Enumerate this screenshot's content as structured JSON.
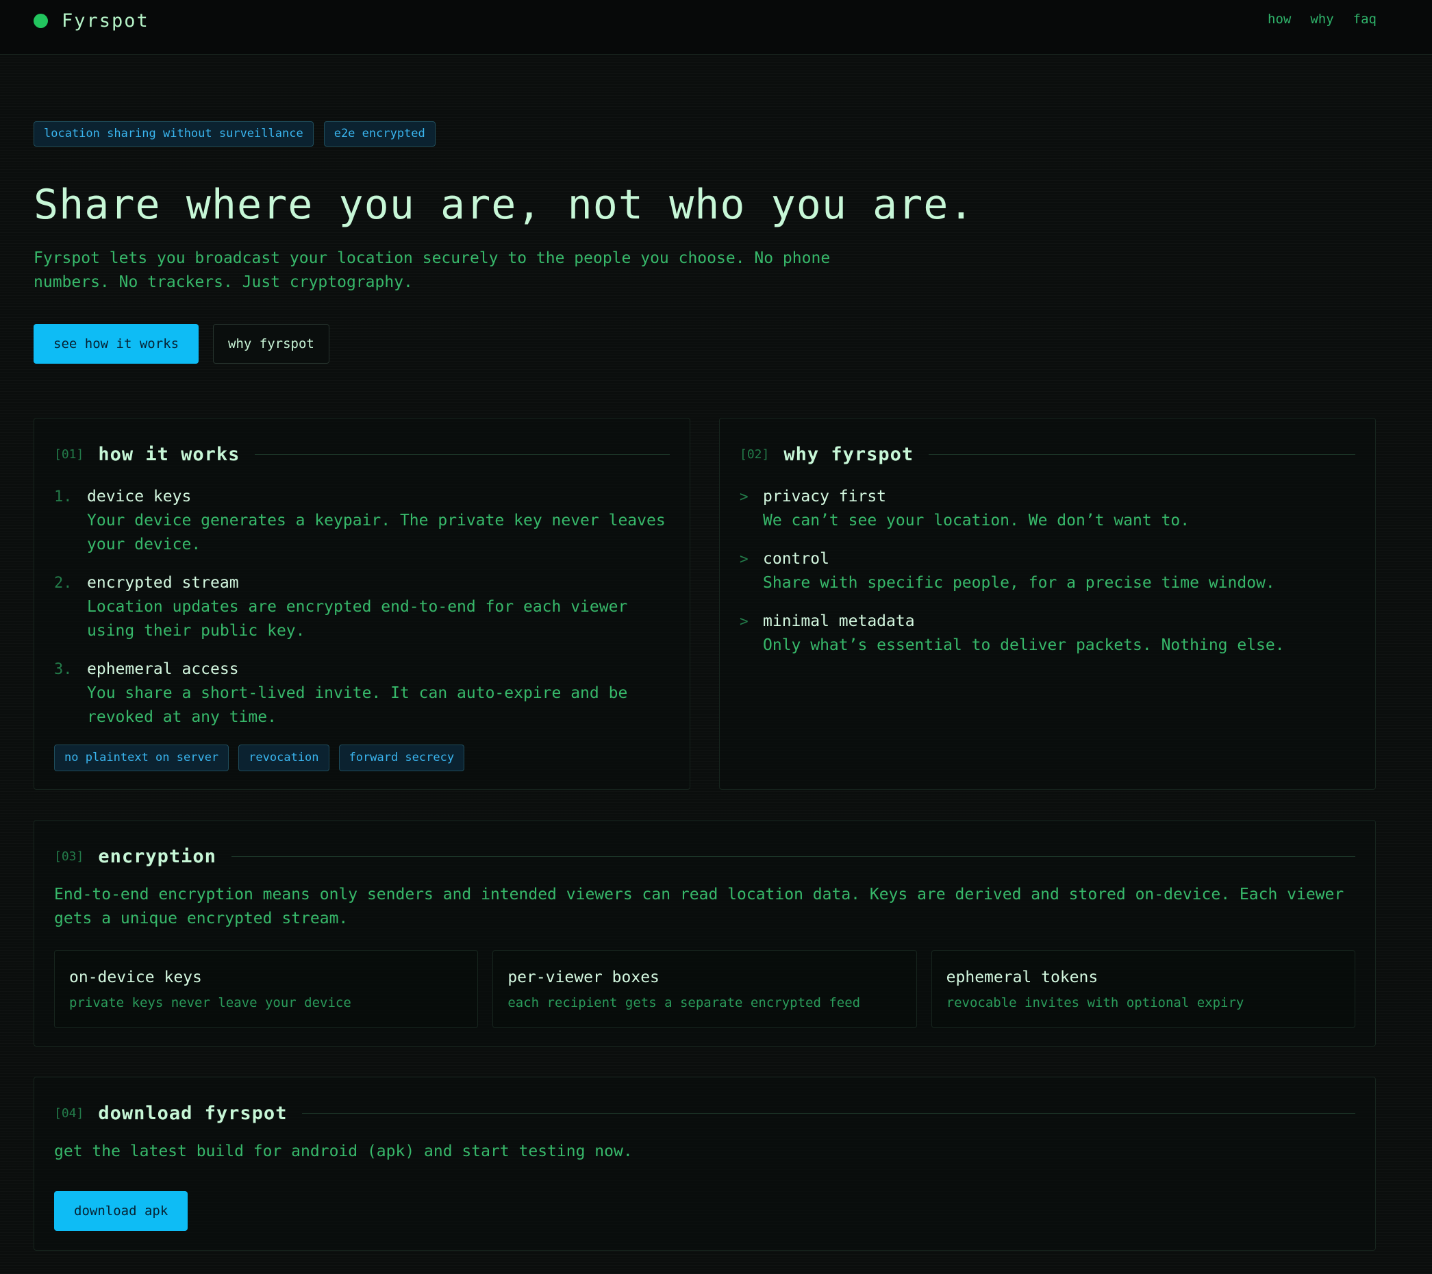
{
  "header": {
    "brand": "Fyrspot",
    "nav": [
      "how",
      "why",
      "faq"
    ]
  },
  "hero": {
    "tags": [
      "location sharing without surveillance",
      "e2e encrypted"
    ],
    "headline": "Share where you are, not who you are.",
    "lede": "Fyrspot lets you broadcast your location securely to the people you choose. No phone numbers. No trackers. Just cryptography.",
    "primary_cta": "see how it works",
    "secondary_cta": "why fyrspot"
  },
  "how": {
    "num": "[01]",
    "title": "how it works",
    "steps": [
      {
        "num": "1.",
        "title": "device keys",
        "desc": "Your device generates a keypair. The private key never leaves your device."
      },
      {
        "num": "2.",
        "title": "encrypted stream",
        "desc": "Location updates are encrypted end-to-end for each viewer using their public key."
      },
      {
        "num": "3.",
        "title": "ephemeral access",
        "desc": "You share a short-lived invite. It can auto-expire and be revoked at any time."
      }
    ],
    "chips": [
      "no plaintext on server",
      "revocation",
      "forward secrecy"
    ]
  },
  "why": {
    "num": "[02]",
    "title": "why fyrspot",
    "items": [
      {
        "title": "privacy first",
        "desc": "We can’t see your location. We don’t want to."
      },
      {
        "title": "control",
        "desc": "Share with specific people, for a precise time window."
      },
      {
        "title": "minimal metadata",
        "desc": "Only what’s essential to deliver packets. Nothing else."
      }
    ]
  },
  "encryption": {
    "num": "[03]",
    "title": "encryption",
    "text": "End-to-end encryption means only senders and intended viewers can read location data. Keys are derived and stored on-device. Each viewer gets a unique encrypted stream.",
    "features": [
      {
        "title": "on-device keys",
        "desc": "private keys never leave your device"
      },
      {
        "title": "per-viewer boxes",
        "desc": "each recipient gets a separate encrypted feed"
      },
      {
        "title": "ephemeral tokens",
        "desc": "revocable invites with optional expiry"
      }
    ]
  },
  "download": {
    "num": "[04]",
    "title": "download fyrspot",
    "text": "get the latest build for android (apk) and start testing now.",
    "button": "download apk"
  },
  "colors": {
    "accent": "#0ebcf5",
    "brand_dot": "#22c55e",
    "text_green": "#37b86a",
    "heading": "#c7f7d7"
  }
}
